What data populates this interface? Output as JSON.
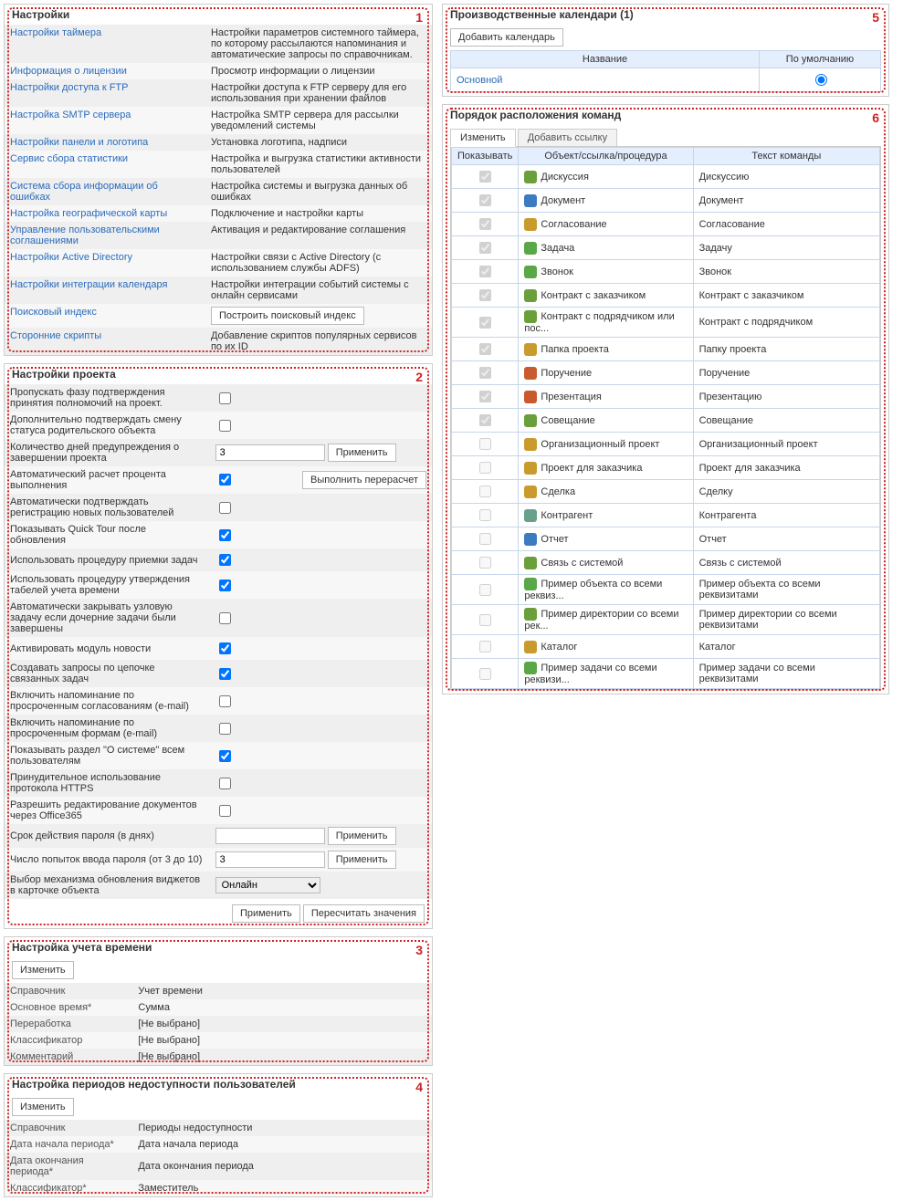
{
  "settings": {
    "title": "Настройки",
    "rows": [
      {
        "name": "Настройки таймера",
        "desc": "Настройки параметров системного таймера, по которому рассылаются напоминания и автоматические запросы по справочникам."
      },
      {
        "name": "Информация о лицензии",
        "desc": "Просмотр информации о лицензии"
      },
      {
        "name": "Настройки доступа к FTP",
        "desc": "Настройки доступа к FTP серверу для его использования при хранении файлов"
      },
      {
        "name": "Настройка SMTP сервера",
        "desc": "Настройка SMTP сервера для рассылки уведомлений системы"
      },
      {
        "name": "Настройки панели и логотипа",
        "desc": "Установка логотипа, надписи"
      },
      {
        "name": "Сервис сбора статистики",
        "desc": "Настройка и выгрузка статистики активности пользователей"
      },
      {
        "name": "Система сбора информации об ошибках",
        "desc": "Настройка системы и выгрузка данных об ошибках"
      },
      {
        "name": "Настройка географической карты",
        "desc": "Подключение и настройки карты"
      },
      {
        "name": "Управление пользовательскими соглашениями",
        "desc": "Активация и редактирование соглашения"
      },
      {
        "name": "Настройки Active Directory",
        "desc": "Настройки связи с Active Directory (с использованием службы ADFS)"
      },
      {
        "name": "Настройки интеграции календаря",
        "desc": "Настройки интеграции событий системы с онлайн сервисами"
      },
      {
        "name": "Поисковый индекс",
        "desc": ""
      },
      {
        "name": "Сторонние скрипты",
        "desc": "Добавление скриптов популярных сервисов по их ID"
      }
    ],
    "build_index_btn": "Построить поисковый индекс"
  },
  "project_settings": {
    "title": "Настройки проекта",
    "rows": [
      {
        "label": "Пропускать фазу подтверждения принятия полномочий на проект.",
        "type": "checkbox",
        "value": false
      },
      {
        "label": "Дополнительно подтверждать смену статуса родительского объекта",
        "type": "checkbox",
        "value": false
      },
      {
        "label": "Количество дней предупреждения о завершении проекта",
        "type": "text_btn",
        "value": "3",
        "btn": "Применить"
      },
      {
        "label": "Автоматический расчет процента выполнения",
        "type": "checkbox_btn",
        "value": true,
        "btn": "Выполнить перерасчет"
      },
      {
        "label": "Автоматически подтверждать регистрацию новых пользователей",
        "type": "checkbox",
        "value": false
      },
      {
        "label": "Показывать Quick Tour после обновления",
        "type": "checkbox",
        "value": true
      },
      {
        "label": "Использовать процедуру приемки задач",
        "type": "checkbox",
        "value": true
      },
      {
        "label": "Использовать процедуру утверждения табелей учета времени",
        "type": "checkbox",
        "value": true
      },
      {
        "label": "Автоматически закрывать узловую задачу если дочерние задачи были завершены",
        "type": "checkbox",
        "value": false
      },
      {
        "label": "Активировать модуль новости",
        "type": "checkbox",
        "value": true
      },
      {
        "label": "Создавать запросы по цепочке связанных задач",
        "type": "checkbox",
        "value": true
      },
      {
        "label": "Включить напоминание по просроченным согласованиям (e-mail)",
        "type": "checkbox",
        "value": false
      },
      {
        "label": "Включить напоминание по просроченным формам (e-mail)",
        "type": "checkbox",
        "value": false
      },
      {
        "label": "Показывать раздел \"О системе\" всем пользователям",
        "type": "checkbox",
        "value": true
      },
      {
        "label": "Принудительное использование протокола HTTPS",
        "type": "checkbox",
        "value": false
      },
      {
        "label": "Разрешить редактирование документов через Office365",
        "type": "checkbox",
        "value": false
      },
      {
        "label": "Срок действия пароля (в днях)",
        "type": "text_btn",
        "value": "",
        "btn": "Применить"
      },
      {
        "label": "Число попыток ввода пароля (от 3 до 10)",
        "type": "text_btn",
        "value": "3",
        "btn": "Применить"
      },
      {
        "label": "Выбор механизма обновления виджетов в карточке объекта",
        "type": "select",
        "value": "Онлайн"
      }
    ],
    "footer": {
      "apply": "Применить",
      "recalc": "Пересчитать значения"
    }
  },
  "time_tracking": {
    "title": "Настройка учета времени",
    "edit_btn": "Изменить",
    "rows": [
      {
        "key": "Справочник",
        "value": "Учет времени"
      },
      {
        "key": "Основное время*",
        "value": "Сумма"
      },
      {
        "key": "Переработка",
        "value": "[Не выбрано]"
      },
      {
        "key": "Классификатор",
        "value": "[Не выбрано]"
      },
      {
        "key": "Комментарий",
        "value": "[Не выбрано]"
      }
    ]
  },
  "unavailability": {
    "title": "Настройка периодов недоступности пользователей",
    "edit_btn": "Изменить",
    "rows": [
      {
        "key": "Справочник",
        "value": "Периоды недоступности"
      },
      {
        "key": "Дата начала периода*",
        "value": "Дата начала периода"
      },
      {
        "key": "Дата окончания периода*",
        "value": "Дата окончания периода"
      },
      {
        "key": "Классификатор*",
        "value": "Заместитель"
      }
    ]
  },
  "calendars": {
    "title": "Производственные календари (1)",
    "add_btn": "Добавить календарь",
    "headers": {
      "name": "Название",
      "default": "По умолчанию"
    },
    "rows": [
      {
        "name": "Основной",
        "default": true
      }
    ]
  },
  "commands": {
    "title": "Порядок расположения команд",
    "tabs": {
      "edit": "Изменить",
      "add_link": "Добавить ссылку"
    },
    "headers": {
      "show": "Показывать",
      "obj": "Объект/ссылка/процедура",
      "text": "Текст команды"
    },
    "rows": [
      {
        "show": true,
        "obj": "Дискуссия",
        "text": "Дискуссию",
        "color": "#6a9f3c"
      },
      {
        "show": true,
        "obj": "Документ",
        "text": "Документ",
        "color": "#3c7bbf"
      },
      {
        "show": true,
        "obj": "Согласование",
        "text": "Согласование",
        "color": "#c99a2e"
      },
      {
        "show": true,
        "obj": "Задача",
        "text": "Задачу",
        "color": "#5aa748"
      },
      {
        "show": true,
        "obj": "Звонок",
        "text": "Звонок",
        "color": "#5aa748"
      },
      {
        "show": true,
        "obj": "Контракт с заказчиком",
        "text": "Контракт с заказчиком",
        "color": "#6a9f3c"
      },
      {
        "show": true,
        "obj": "Контракт с подрядчиком или пос...",
        "text": "Контракт с подрядчиком",
        "color": "#6a9f3c"
      },
      {
        "show": true,
        "obj": "Папка проекта",
        "text": "Папку проекта",
        "color": "#c99a2e"
      },
      {
        "show": true,
        "obj": "Поручение",
        "text": "Поручение",
        "color": "#c95a2e"
      },
      {
        "show": true,
        "obj": "Презентация",
        "text": "Презентацию",
        "color": "#c95a2e"
      },
      {
        "show": true,
        "obj": "Совещание",
        "text": "Совещание",
        "color": "#6a9f3c"
      },
      {
        "show": false,
        "obj": "Организационный проект",
        "text": "Организационный проект",
        "color": "#c99a2e"
      },
      {
        "show": false,
        "obj": "Проект для заказчика",
        "text": "Проект для заказчика",
        "color": "#c99a2e"
      },
      {
        "show": false,
        "obj": "Сделка",
        "text": "Сделку",
        "color": "#c99a2e"
      },
      {
        "show": false,
        "obj": "Контрагент",
        "text": "Контрагента",
        "color": "#6a9f8c"
      },
      {
        "show": false,
        "obj": "Отчет",
        "text": "Отчет",
        "color": "#3c7bbf"
      },
      {
        "show": false,
        "obj": "Связь с системой",
        "text": "Связь с системой",
        "color": "#6a9f3c"
      },
      {
        "show": false,
        "obj": "Пример объекта со всеми реквиз...",
        "text": "Пример объекта со всеми реквизитами",
        "color": "#5aa748"
      },
      {
        "show": false,
        "obj": "Пример директории со всеми рек...",
        "text": "Пример директории со всеми реквизитами",
        "color": "#6a9f3c"
      },
      {
        "show": false,
        "obj": "Каталог",
        "text": "Каталог",
        "color": "#c99a2e"
      },
      {
        "show": false,
        "obj": "Пример задачи со всеми реквизи...",
        "text": "Пример задачи со всеми реквизитами",
        "color": "#5aa748"
      }
    ]
  },
  "annotation_numbers": {
    "1": "1",
    "2": "2",
    "3": "3",
    "4": "4",
    "5": "5",
    "6": "6"
  }
}
